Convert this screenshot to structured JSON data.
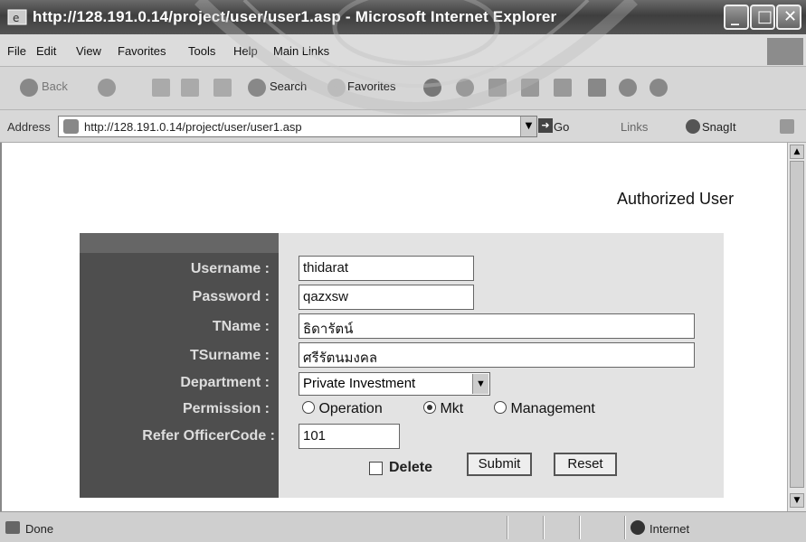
{
  "window": {
    "title": "http://128.191.0.14/project/user/user1.asp - Microsoft Internet Explorer"
  },
  "menu": [
    "File",
    "Edit",
    "View",
    "Favorites",
    "Tools",
    "Help",
    "Main Links"
  ],
  "toolbar": {
    "back": "Back",
    "search": "Search",
    "favorites": "Favorites"
  },
  "address": {
    "label": "Address",
    "url": "http://128.191.0.14/project/user/user1.asp",
    "go": "Go",
    "links": "Links",
    "snagit": "SnagIt"
  },
  "page": {
    "heading": "Authorized User",
    "labels": {
      "username": "Username :",
      "password": "Password :",
      "tname": "TName :",
      "tsurname": "TSurname :",
      "department": "Department :",
      "permission": "Permission :",
      "refer": "Refer OfficerCode :"
    },
    "values": {
      "username": "thidarat",
      "password": "qazxsw",
      "tname": "ธิดารัตน์",
      "tsurname": "ศรีรัตนมงคล",
      "department": "Private Investment",
      "refer": "101"
    },
    "permission_options": [
      "Operation",
      "Mkt",
      "Management"
    ],
    "permission_selected": "Mkt",
    "delete_label": "Delete",
    "delete_checked": false,
    "submit": "Submit",
    "reset": "Reset"
  },
  "status": {
    "text": "Done",
    "zone": "Internet"
  }
}
